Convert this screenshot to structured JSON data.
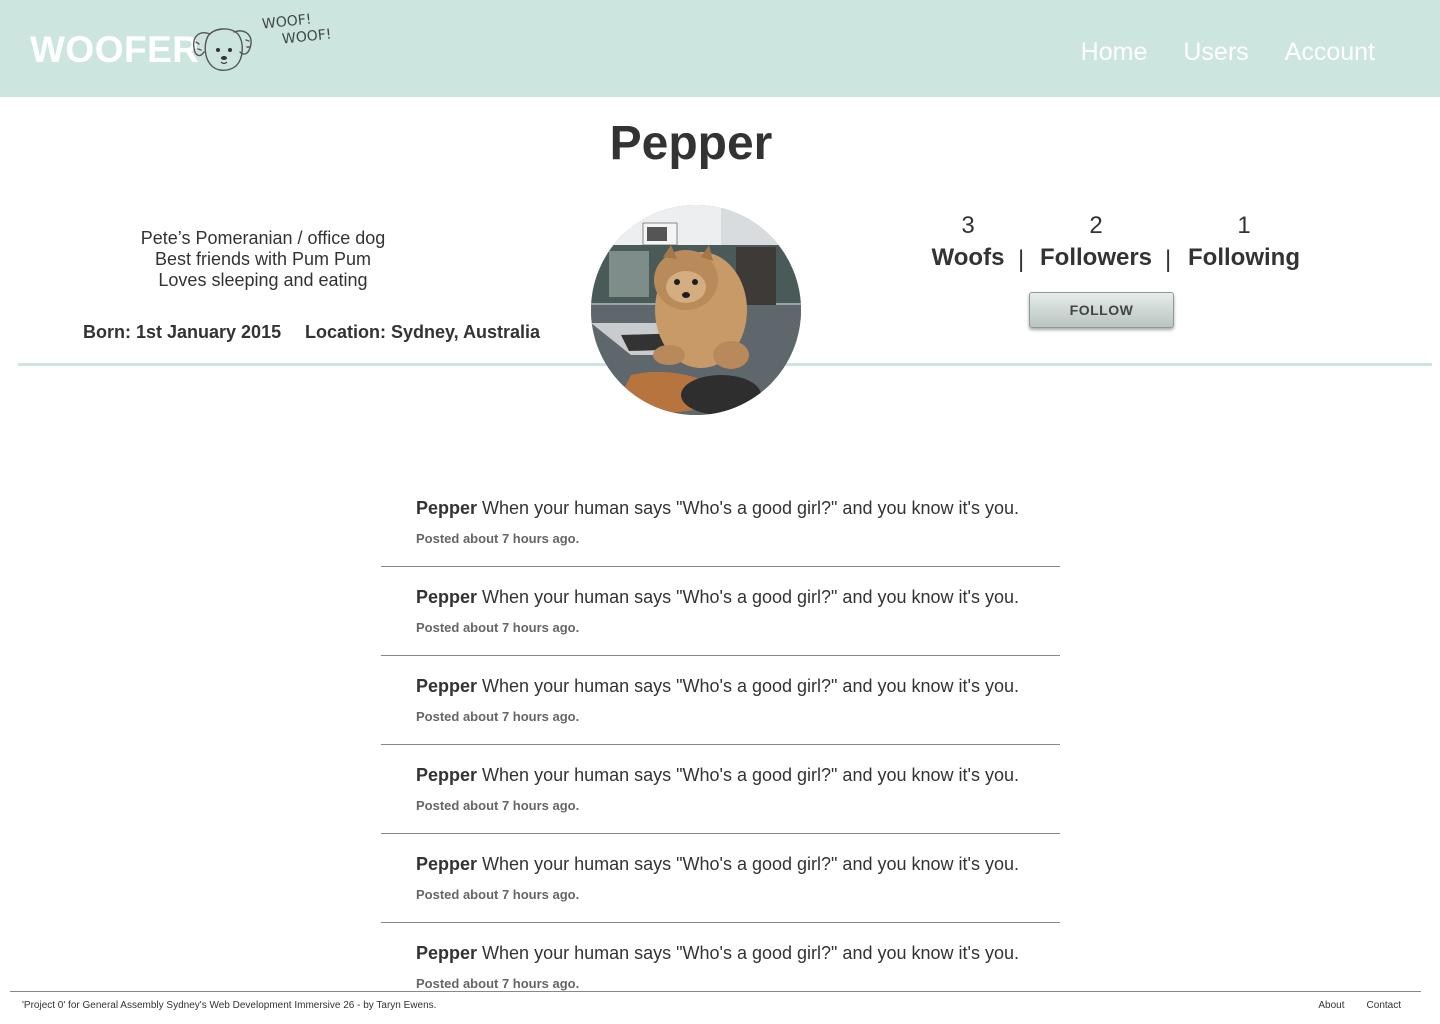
{
  "header": {
    "brand": "WOOFER",
    "woof_line1": "WOOF!",
    "woof_line2": "WOOF!",
    "nav": [
      "Home",
      "Users",
      "Account"
    ],
    "background": "#cce6df"
  },
  "profile": {
    "name": "Pepper",
    "bio": [
      "Pete’s Pomeranian / office dog",
      "Best friends with Pum Pum",
      "Loves sleeping and eating"
    ],
    "born": "Born: 1st January 2015",
    "location": "Location: Sydney, Australia",
    "stats": {
      "woofs": {
        "count": "3",
        "label": "Woofs"
      },
      "followers": {
        "count": "2",
        "label": "Followers"
      },
      "following": {
        "count": "1",
        "label": "Following"
      },
      "separator": "|"
    },
    "follow_button": "FOLLOW"
  },
  "feed": {
    "posts": [
      {
        "author": "Pepper",
        "text": "When your human says \"Who's a good girl?\" and you know it's you.",
        "time": "Posted about 7 hours ago."
      },
      {
        "author": "Pepper",
        "text": "When your human says \"Who's a good girl?\" and you know it's you.",
        "time": "Posted about 7 hours ago."
      },
      {
        "author": "Pepper",
        "text": "When your human says \"Who's a good girl?\" and you know it's you.",
        "time": "Posted about 7 hours ago."
      },
      {
        "author": "Pepper",
        "text": "When your human says \"Who's a good girl?\" and you know it's you.",
        "time": "Posted about 7 hours ago."
      },
      {
        "author": "Pepper",
        "text": "When your human says \"Who's a good girl?\" and you know it's you.",
        "time": "Posted about 7 hours ago."
      },
      {
        "author": "Pepper",
        "text": "When your human says \"Who's a good girl?\" and you know it's you.",
        "time": "Posted about 7 hours ago."
      }
    ]
  },
  "footer": {
    "credit": "'Project 0' for General Assembly Sydney's Web Development Immersive 26 - by Taryn Ewens.",
    "links": [
      "About",
      "Contact"
    ]
  }
}
